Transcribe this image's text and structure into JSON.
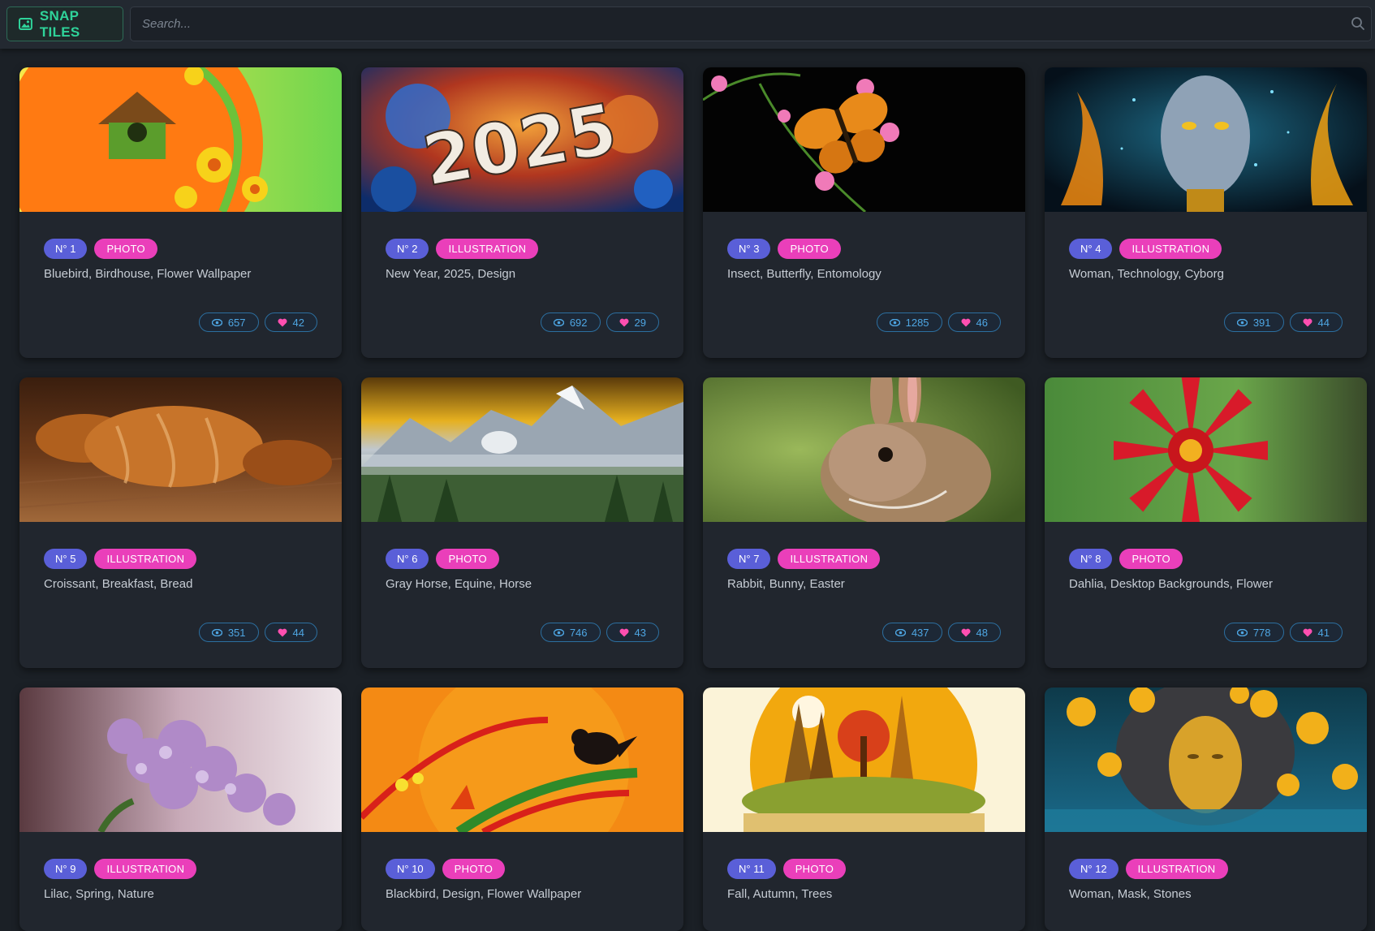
{
  "app": {
    "name": "SNAP TILES",
    "accent": "#2fd39a"
  },
  "search": {
    "placeholder": "Search..."
  },
  "cards": [
    {
      "num": "N° 1",
      "type": "PHOTO",
      "tags": "Bluebird, Birdhouse, Flower Wallpaper",
      "views": "657",
      "likes": "42"
    },
    {
      "num": "N° 2",
      "type": "ILLUSTRATION",
      "tags": "New Year, 2025, Design",
      "views": "692",
      "likes": "29",
      "image_text": "2025"
    },
    {
      "num": "N° 3",
      "type": "PHOTO",
      "tags": "Insect, Butterfly, Entomology",
      "views": "1285",
      "likes": "46"
    },
    {
      "num": "N° 4",
      "type": "ILLUSTRATION",
      "tags": "Woman, Technology, Cyborg",
      "views": "391",
      "likes": "44"
    },
    {
      "num": "N° 5",
      "type": "ILLUSTRATION",
      "tags": "Croissant, Breakfast, Bread",
      "views": "351",
      "likes": "44"
    },
    {
      "num": "N° 6",
      "type": "PHOTO",
      "tags": "Gray Horse, Equine, Horse",
      "views": "746",
      "likes": "43"
    },
    {
      "num": "N° 7",
      "type": "ILLUSTRATION",
      "tags": "Rabbit, Bunny, Easter",
      "views": "437",
      "likes": "48"
    },
    {
      "num": "N° 8",
      "type": "PHOTO",
      "tags": "Dahlia, Desktop Backgrounds, Flower",
      "views": "778",
      "likes": "41"
    },
    {
      "num": "N° 9",
      "type": "ILLUSTRATION",
      "tags": "Lilac, Spring, Nature"
    },
    {
      "num": "N° 10",
      "type": "PHOTO",
      "tags": "Blackbird, Design, Flower Wallpaper"
    },
    {
      "num": "N° 11",
      "type": "PHOTO",
      "tags": "Fall, Autumn, Trees"
    },
    {
      "num": "N° 12",
      "type": "ILLUSTRATION",
      "tags": "Woman, Mask, Stones"
    }
  ],
  "colors": {
    "badge_number": "#5a5fd8",
    "badge_type": "#ea3fba",
    "stat_border": "#2c6fa0",
    "stat_text": "#4ea6e3",
    "like": "#ff4fb0"
  }
}
